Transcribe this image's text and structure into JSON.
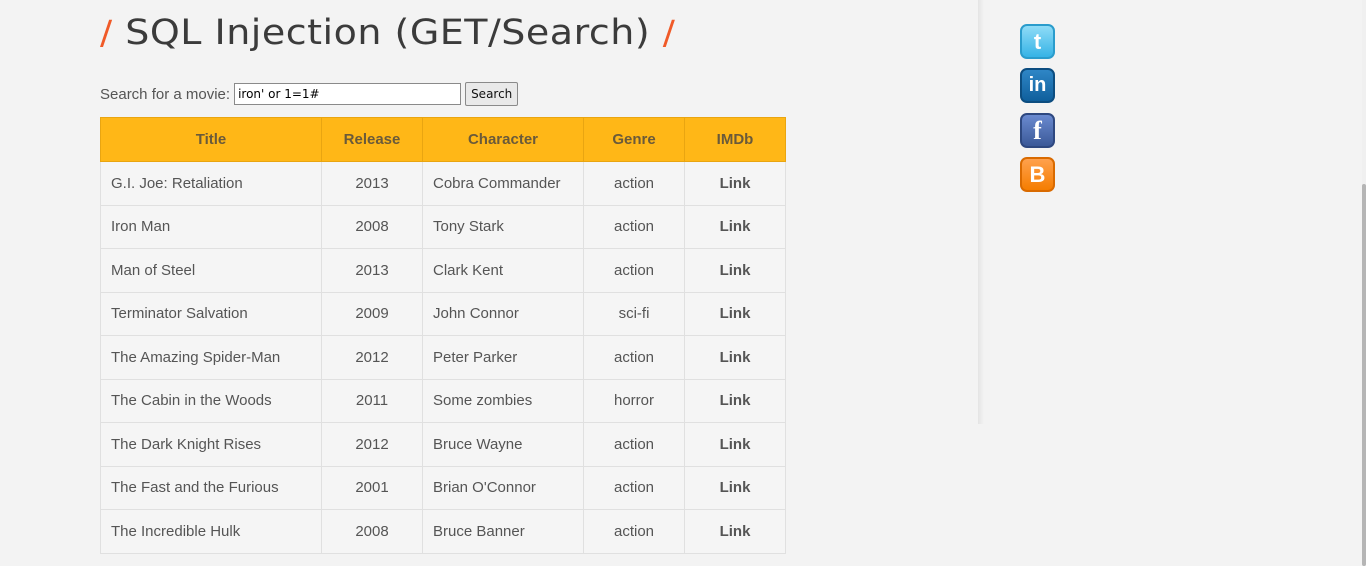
{
  "header": {
    "slash_left": "/",
    "title": "SQL Injection (GET/Search)",
    "slash_right": "/"
  },
  "search": {
    "label": "Search for a movie:",
    "value": "iron' or 1=1#",
    "button_label": "Search"
  },
  "table": {
    "columns": [
      "Title",
      "Release",
      "Character",
      "Genre",
      "IMDb"
    ],
    "rows": [
      {
        "title": "G.I. Joe: Retaliation",
        "release": "2013",
        "character": "Cobra Commander",
        "genre": "action",
        "imdb": "Link"
      },
      {
        "title": "Iron Man",
        "release": "2008",
        "character": "Tony Stark",
        "genre": "action",
        "imdb": "Link"
      },
      {
        "title": "Man of Steel",
        "release": "2013",
        "character": "Clark Kent",
        "genre": "action",
        "imdb": "Link"
      },
      {
        "title": "Terminator Salvation",
        "release": "2009",
        "character": "John Connor",
        "genre": "sci-fi",
        "imdb": "Link"
      },
      {
        "title": "The Amazing Spider-Man",
        "release": "2012",
        "character": "Peter Parker",
        "genre": "action",
        "imdb": "Link"
      },
      {
        "title": "The Cabin in the Woods",
        "release": "2011",
        "character": "Some zombies",
        "genre": "horror",
        "imdb": "Link"
      },
      {
        "title": "The Dark Knight Rises",
        "release": "2012",
        "character": "Bruce Wayne",
        "genre": "action",
        "imdb": "Link"
      },
      {
        "title": "The Fast and the Furious",
        "release": "2001",
        "character": "Brian O'Connor",
        "genre": "action",
        "imdb": "Link"
      },
      {
        "title": "The Incredible Hulk",
        "release": "2008",
        "character": "Bruce Banner",
        "genre": "action",
        "imdb": "Link"
      }
    ]
  },
  "social": [
    {
      "icon": "twitter-icon",
      "glyph": "t"
    },
    {
      "icon": "linkedin-icon",
      "glyph": "in"
    },
    {
      "icon": "facebook-icon",
      "glyph": "f"
    },
    {
      "icon": "blogger-icon",
      "glyph": "B"
    }
  ],
  "colors": {
    "accent": "#f05a28",
    "table_header": "#ffb717"
  }
}
